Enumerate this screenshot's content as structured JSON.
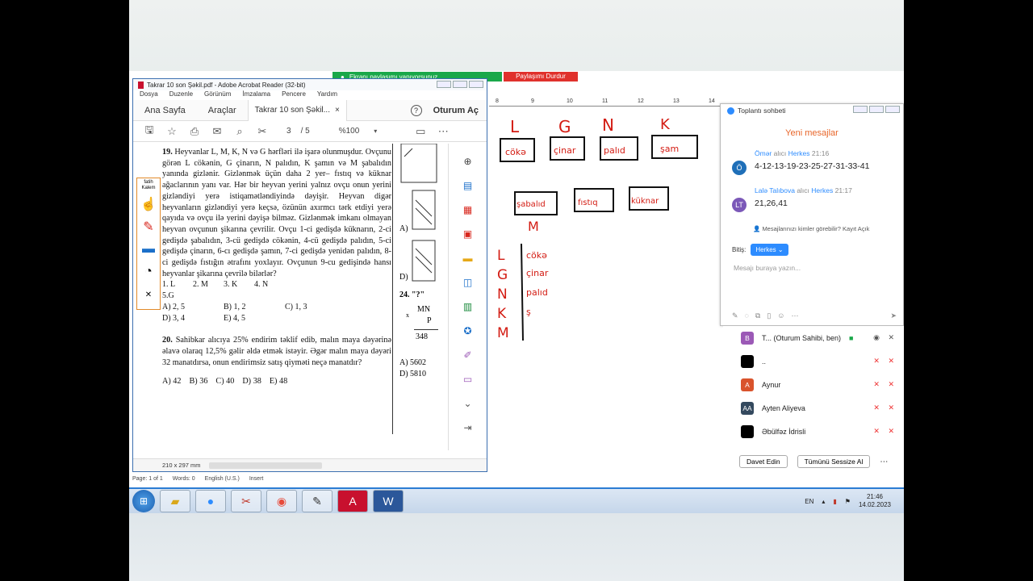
{
  "share_bar": {
    "status": "Ekranı paylaşımı yapıyorsunuz",
    "stop": "Paylaşımı Durdur"
  },
  "acrobat": {
    "title": "Takrar 10 son Şəkil.pdf - Adobe Acrobat Reader (32-bit)",
    "menu": [
      "Dosya",
      "Duzenle",
      "Görünüm",
      "İmzalama",
      "Pencere",
      "Yardım"
    ],
    "tabs": {
      "home": "Ana Sayfa",
      "tools": "Araçlar",
      "doc": "Takrar 10 son Şəkil...",
      "help": "?",
      "signin": "Oturum Aç"
    },
    "toolbar": {
      "page": "3",
      "pages": "/ 5",
      "zoom": "%100"
    },
    "status": {
      "size": "210 x 297 mm",
      "page_info": "Page: 1 of 1",
      "words": "Words: 0",
      "lang": "English (U.S.)",
      "mode": "Insert"
    }
  },
  "pen_tools": {
    "brand": "fatih Kalem"
  },
  "question19": {
    "number": "19.",
    "text": "Heyvanlar L, M, K, N və G hərfləri ilə işarə olunmuşdur. Ovçunu görən L cökənin, G çinarın, N palıdın, K şamın və M şabalıdın yanında gizlənir. Gizlənmək üçün daha 2 yer– fıstıq və küknar ağaclarının yanı var. Hər bir heyvan yerini yalnız ovçu onun yerini gizləndiyi yerə istiqamətləndiyində dəyişir. Heyvan digər heyvanların gizləndiyi yerə keçsə, özünün axırmcı tərk etdiyi yerə qayıda və ovçu ilə yerini dəyişə bilməz. Gizlənmək imkanı olmayan heyvan ovçunun şikarına çevrilir. Ovçu 1-ci gedişdə küknarın, 2-ci gedişdə şabalıdın, 3-cü gedişdə cökənin, 4-cü gedişdə palıdın, 5-ci gedişdə çinarın, 6-cı gedişdə şamın, 7-ci gedişdə yenidən palıdın, 8-ci gedişdə fıstığın ətrafını yoxlayır. Ovçunun 9-cu gedişində hansı heyvanlar şikarına çevrilə bilərlər?",
    "items": [
      "1. L",
      "2. M",
      "3. K",
      "4. N",
      "5.G"
    ],
    "options": [
      "A) 2, 5",
      "B) 1, 2",
      "C) 1, 3",
      "D) 3, 4",
      "E) 4, 5"
    ]
  },
  "question20": {
    "number": "20.",
    "text": "Sahibkar alıcıya 25% endirim təklif edib, malın maya dəyərinə əlavə olaraq 12,5% gəlir əldə etmək istəyir. Əgər malın maya dəyəri 32 manatdırsa, onun endirimsiz satış qiyməti neçə manatdır?",
    "options": [
      "A) 42",
      "B) 36",
      "C) 40",
      "D) 38",
      "E) 48"
    ]
  },
  "right_column": {
    "opt_a": "A)",
    "opt_d": "D)",
    "q24": "24.",
    "q24_text": "\"?\"",
    "mult_sign": "x",
    "mn": "MN",
    "p": "P",
    "result": "348",
    "ans_a": "A) 5602",
    "ans_d": "D) 5810"
  },
  "whiteboard": {
    "ruler": [
      "8",
      "9",
      "10",
      "11",
      "12",
      "13",
      "14"
    ],
    "letters": [
      "L",
      "G",
      "N",
      "K"
    ],
    "boxes_row1": [
      "cökə",
      "çinar",
      "palıd",
      "şam"
    ],
    "boxes_row2": [
      "şabalıd",
      "fıstıq",
      "küknar"
    ],
    "m_label": "M",
    "table": [
      {
        "k": "L",
        "v": "cökə"
      },
      {
        "k": "G",
        "v": "çinar"
      },
      {
        "k": "N",
        "v": "palıd"
      },
      {
        "k": "K",
        "v": "ş"
      },
      {
        "k": "M",
        "v": ""
      }
    ]
  },
  "chat": {
    "title": "Toplantı sohbeti",
    "new_messages": "Yeni mesajlar",
    "messages": [
      {
        "from": "Ömər",
        "to": "alıcı",
        "target": "Herkes",
        "time": "21:16",
        "initials": "Ö",
        "color": "#1f6fb8",
        "body": "4-12-13-19-23-25-27-31-33-41"
      },
      {
        "from": "Lalə Talıbova",
        "to": "alıcı",
        "target": "Herkes",
        "time": "21:17",
        "initials": "LT",
        "color": "#7b58b8",
        "body": "21,26,41"
      }
    ],
    "privacy": "Mesajlarınızı kimler görebilir? Kayıt Açık",
    "to_label": "Bitiş:",
    "to_value": "Herkes",
    "placeholder": "Mesajı buraya yazın..."
  },
  "participants": {
    "list": [
      {
        "initials": "B",
        "name": "T... (Oturum Sahibi, ben)",
        "color": "#9b59b6"
      },
      {
        "initials": "",
        "name": "..",
        "color": "#000000"
      },
      {
        "initials": "A",
        "name": "Aynur",
        "color": "#d9532c"
      },
      {
        "initials": "AA",
        "name": "Ayten Aliyeva",
        "color": "#34495e"
      },
      {
        "initials": "",
        "name": "Əbülfəz İdrisli",
        "color": "#000000"
      }
    ],
    "invite": "Davet Edin",
    "mute_all": "Tümünü Sessize Al"
  },
  "taskbar": {
    "apps": [
      "windows-explorer",
      "zoom",
      "snipping",
      "chrome",
      "pen",
      "acrobat",
      "word"
    ],
    "lang": "EN",
    "time": "21:46",
    "date": "14.02.2023"
  }
}
